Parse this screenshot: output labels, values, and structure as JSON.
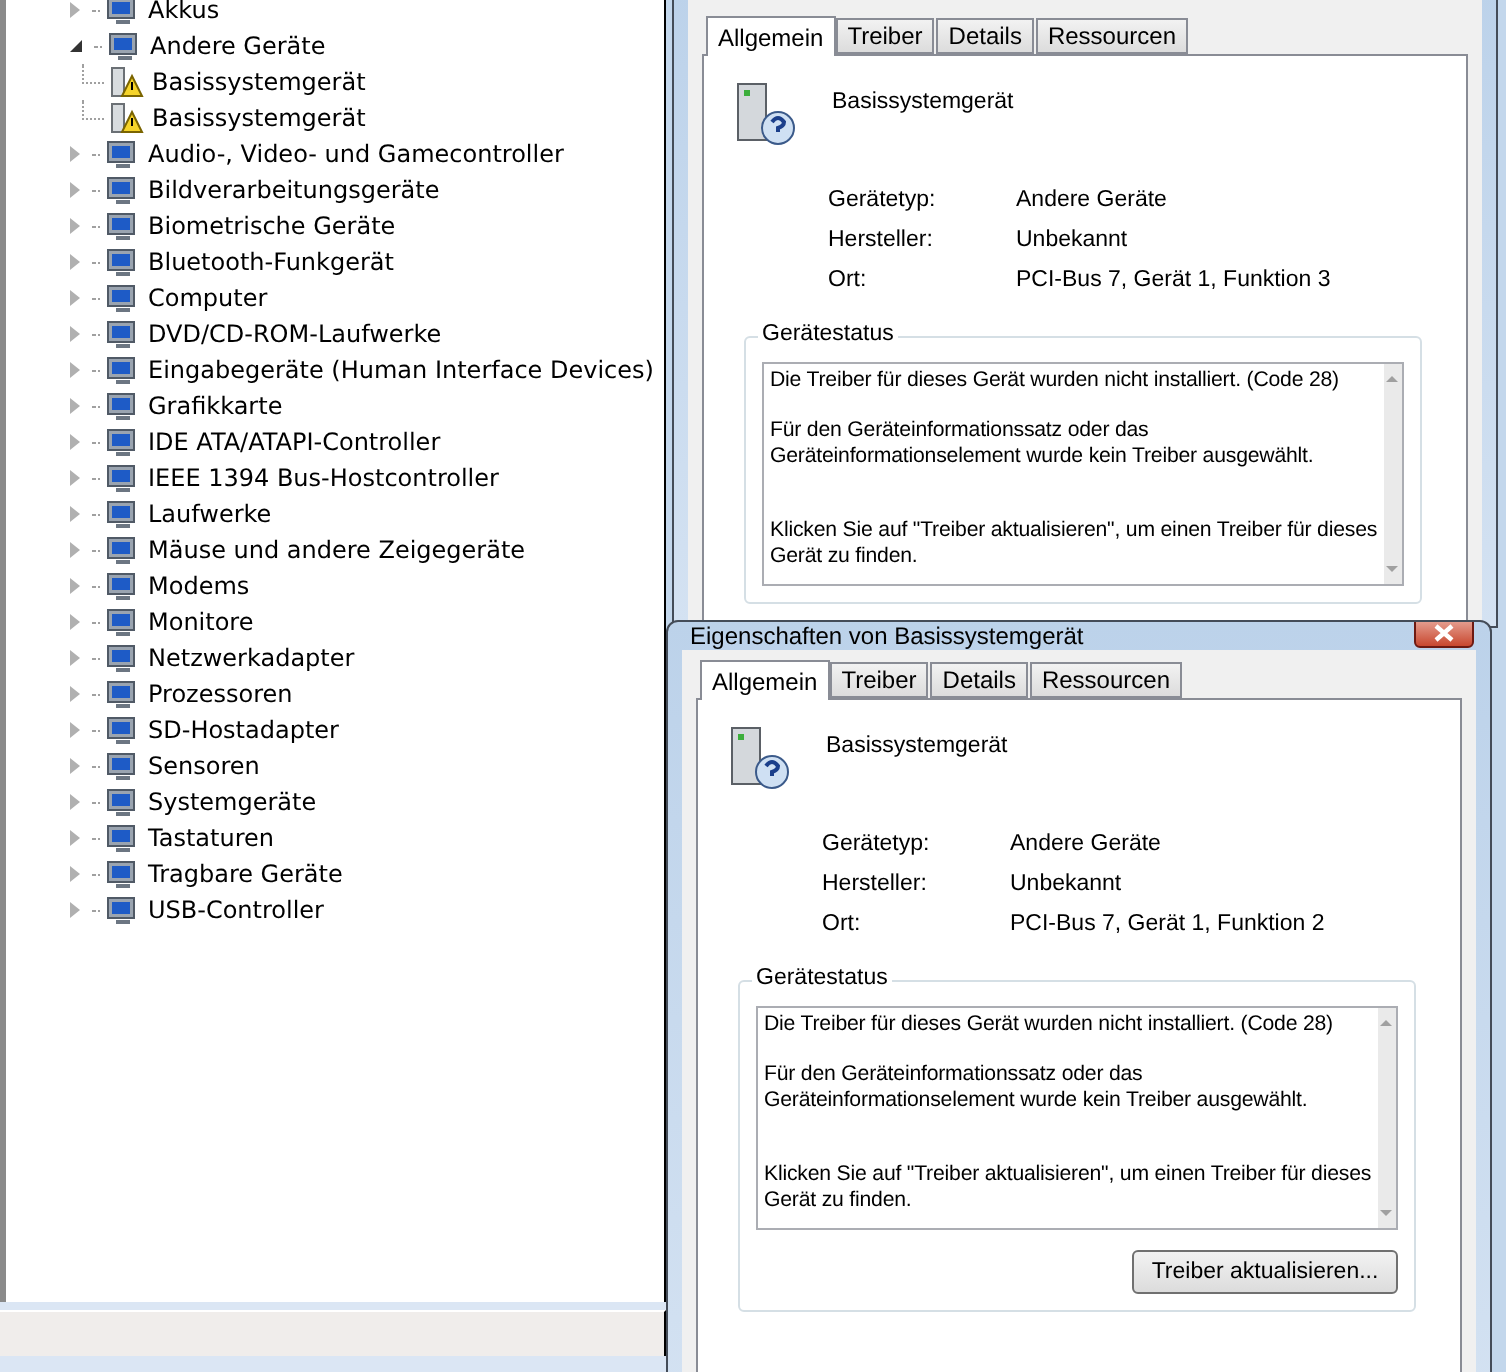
{
  "device_manager": {
    "tree": [
      {
        "label": "Akkus",
        "expanded": false
      },
      {
        "label": "Andere Geräte",
        "expanded": true,
        "children": [
          {
            "label": "Basissystemgerät"
          },
          {
            "label": "Basissystemgerät"
          }
        ]
      },
      {
        "label": "Audio-, Video- und Gamecontroller",
        "expanded": false
      },
      {
        "label": "Bildverarbeitungsgeräte",
        "expanded": false
      },
      {
        "label": "Biometrische Geräte",
        "expanded": false
      },
      {
        "label": "Bluetooth-Funkgerät",
        "expanded": false
      },
      {
        "label": "Computer",
        "expanded": false
      },
      {
        "label": "DVD/CD-ROM-Laufwerke",
        "expanded": false
      },
      {
        "label": "Eingabegeräte (Human Interface Devices)",
        "expanded": false
      },
      {
        "label": "Grafikkarte",
        "expanded": false
      },
      {
        "label": "IDE ATA/ATAPI-Controller",
        "expanded": false
      },
      {
        "label": "IEEE 1394 Bus-Hostcontroller",
        "expanded": false
      },
      {
        "label": "Laufwerke",
        "expanded": false
      },
      {
        "label": "Mäuse und andere Zeigegeräte",
        "expanded": false
      },
      {
        "label": "Modems",
        "expanded": false
      },
      {
        "label": "Monitore",
        "expanded": false
      },
      {
        "label": "Netzwerkadapter",
        "expanded": false
      },
      {
        "label": "Prozessoren",
        "expanded": false
      },
      {
        "label": "SD-Hostadapter",
        "expanded": false
      },
      {
        "label": "Sensoren",
        "expanded": false
      },
      {
        "label": "Systemgeräte",
        "expanded": false
      },
      {
        "label": "Tastaturen",
        "expanded": false
      },
      {
        "label": "Tragbare Geräte",
        "expanded": false
      },
      {
        "label": "USB-Controller",
        "expanded": false
      }
    ]
  },
  "dialogs": [
    {
      "tabs": [
        {
          "label": "Allgemein",
          "selected": true
        },
        {
          "label": "Treiber",
          "selected": false
        },
        {
          "label": "Details",
          "selected": false
        },
        {
          "label": "Ressourcen",
          "selected": false
        }
      ],
      "device_name": "Basissystemgerät",
      "properties": [
        {
          "label": "Gerätetyp:",
          "value": "Andere Geräte"
        },
        {
          "label": "Hersteller:",
          "value": "Unbekannt"
        },
        {
          "label": "Ort:",
          "value": "PCI-Bus 7, Gerät 1, Funktion 3"
        }
      ],
      "status_title": "Gerätestatus",
      "status_text": "Die Treiber für dieses Gerät wurden nicht installiert. (Code 28)\n\nFür den Geräteinformationssatz oder das\nGeräteinformationselement wurde kein Treiber ausgewählt.\n\n\nKlicken Sie auf \"Treiber aktualisieren\", um einen Treiber für dieses\nGerät zu finden."
    },
    {
      "title": "Eigenschaften von Basissystemgerät",
      "tabs": [
        {
          "label": "Allgemein",
          "selected": true
        },
        {
          "label": "Treiber",
          "selected": false
        },
        {
          "label": "Details",
          "selected": false
        },
        {
          "label": "Ressourcen",
          "selected": false
        }
      ],
      "device_name": "Basissystemgerät",
      "properties": [
        {
          "label": "Gerätetyp:",
          "value": "Andere Geräte"
        },
        {
          "label": "Hersteller:",
          "value": "Unbekannt"
        },
        {
          "label": "Ort:",
          "value": "PCI-Bus 7, Gerät 1, Funktion 2"
        }
      ],
      "status_title": "Gerätestatus",
      "status_text": "Die Treiber für dieses Gerät wurden nicht installiert. (Code 28)\n\nFür den Geräteinformationssatz oder das\nGeräteinformationselement wurde kein Treiber ausgewählt.\n\n\nKlicken Sie auf \"Treiber aktualisieren\", um einen Treiber für dieses\nGerät zu finden.",
      "button": "Treiber aktualisieren..."
    }
  ]
}
